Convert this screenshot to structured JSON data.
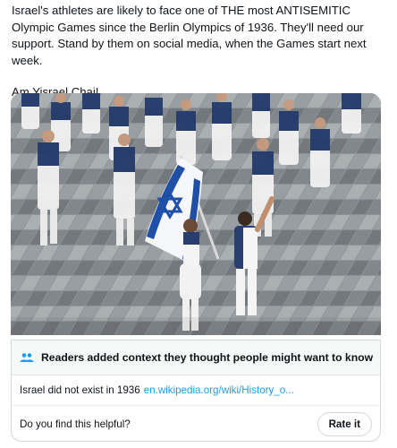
{
  "tweet": {
    "text_line1": "Israel's athletes are likely to face one of THE most ANTISEMITIC Olympic Games since the Berlin Olympics of 1936. They'll need our support. Stand by them on social media, when the Games start next week.",
    "text_line2": "Am Yisrael Chai!"
  },
  "media": {
    "icon": "olympic-parade-photo"
  },
  "community_note": {
    "icon": "people-icon",
    "title": "Readers added context they thought people might want to know",
    "body_text": "Israel did not exist in 1936",
    "link_text": "en.wikipedia.org/wiki/History_o...",
    "helpful_question": "Do you find this helpful?",
    "rate_button_label": "Rate it"
  },
  "colors": {
    "link": "#1d9bf0",
    "note_header_bg": "#f7f9f9",
    "border": "#cfd9de"
  }
}
